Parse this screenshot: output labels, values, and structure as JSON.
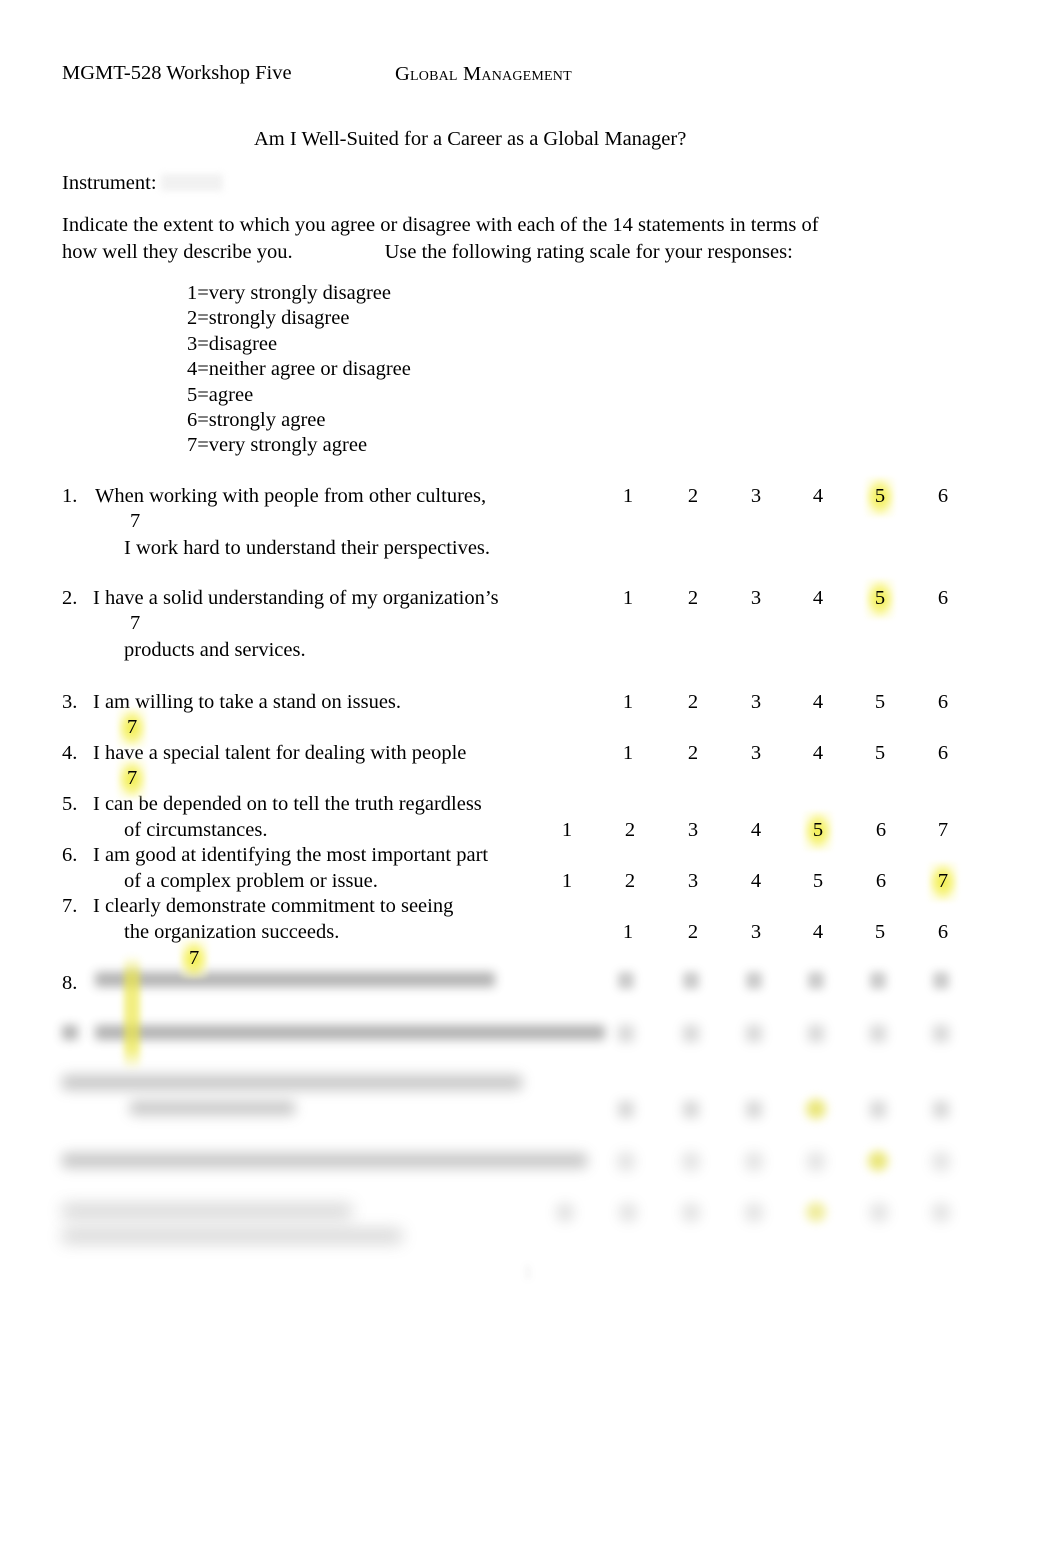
{
  "header": {
    "left": "MGMT-528 Workshop Five",
    "right": "Global  Management"
  },
  "title": "Am I Well-Suited for a Career as a Global Manager?",
  "instrument": {
    "label": "Instrument:",
    "value_redacted": ""
  },
  "intro": {
    "line1": "Indicate the extent to which you agree or disagree with each of the 14 statements in terms of",
    "line2a": "how well they describe you.",
    "line2b": "Use the following rating scale for your responses:"
  },
  "rating_scale": [
    "1=very strongly disagree",
    "2=strongly disagree",
    "3=disagree",
    "4=neither agree or disagree",
    "5=agree",
    "6=strongly agree",
    "7=very strongly agree"
  ],
  "scale_values": [
    "1",
    "2",
    "3",
    "4",
    "5",
    "6",
    "7"
  ],
  "questions": [
    {
      "number": "1.",
      "line1": "When working with people from other cultures,",
      "line2": "I work hard to understand their perspectives.",
      "wrapped_seven": "7",
      "selected": "5"
    },
    {
      "number": "2.",
      "line1": "I have a solid understanding of my organization’s",
      "line2": "products and services.",
      "wrapped_seven": "7",
      "selected": "5"
    },
    {
      "number": "3.",
      "line1": "I am willing to take a stand on issues.",
      "line2": "",
      "wrapped_seven": "7",
      "selected": "7"
    },
    {
      "number": "4.",
      "line1": "I have a special talent for dealing with people",
      "line2": "",
      "wrapped_seven": "7",
      "selected": "7"
    },
    {
      "number": "5.",
      "line1": "I can be depended on to tell the truth regardless",
      "line2": "of circumstances.",
      "wrapped_seven": "",
      "selected": "5"
    },
    {
      "number": "6.",
      "line1": "I am good at identifying the most important part",
      "line2": "of a complex problem or issue.",
      "wrapped_seven": "",
      "selected": "7"
    },
    {
      "number": "7.",
      "line1": "I clearly demonstrate commitment to seeing",
      "line2": "the organization succeeds.",
      "wrapped_seven": "7",
      "selected": "7"
    },
    {
      "number": "8.",
      "line1": "",
      "line2": "",
      "wrapped_seven": "",
      "selected": ""
    }
  ],
  "page_number": "1",
  "colors": {
    "highlight": "#f0ec3c",
    "text": "#000000",
    "page": "#ffffff",
    "redaction": "#efefef"
  }
}
